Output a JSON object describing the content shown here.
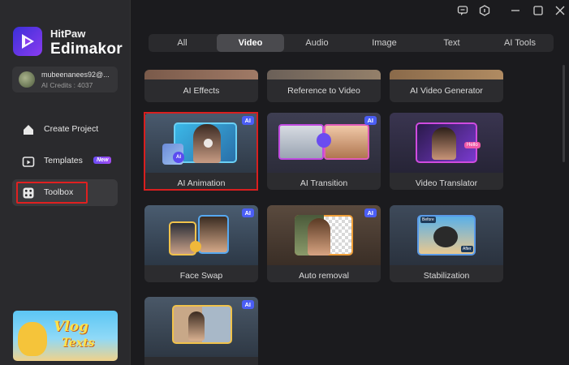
{
  "app": {
    "brand_top": "HitPaw",
    "brand_main": "Edimakor"
  },
  "account": {
    "email": "mubeenanees92@...",
    "credits": "AI Credits : 4037"
  },
  "sidebar": {
    "items": [
      {
        "label": "Create Project",
        "icon": "home-icon"
      },
      {
        "label": "Templates",
        "icon": "templates-icon",
        "badge": "New"
      },
      {
        "label": "Toolbox",
        "icon": "toolbox-icon",
        "active": true
      }
    ],
    "banner": {
      "line1": "Vlog",
      "line2": "Texts"
    }
  },
  "tabs": [
    {
      "label": "All"
    },
    {
      "label": "Video",
      "active": true
    },
    {
      "label": "Audio"
    },
    {
      "label": "Image"
    },
    {
      "label": "Text"
    },
    {
      "label": "AI Tools"
    }
  ],
  "tools": {
    "row0": [
      {
        "title": "AI Effects"
      },
      {
        "title": "Reference to Video"
      },
      {
        "title": "AI Video Generator"
      }
    ],
    "row1": [
      {
        "title": "AI Animation",
        "badge": "AI"
      },
      {
        "title": "AI Transition",
        "badge": "AI"
      },
      {
        "title": "Video Translator"
      }
    ],
    "row2": [
      {
        "title": "Face Swap",
        "badge": "AI"
      },
      {
        "title": "Auto removal",
        "badge": "AI"
      },
      {
        "title": "Stabilization"
      }
    ],
    "row3": [
      {
        "title": "",
        "badge": "AI"
      }
    ]
  },
  "thumb_labels": {
    "hello": "Hello",
    "before": "Before",
    "after": "After"
  },
  "colors": {
    "accent": "#4b5ef5",
    "highlight": "#e02020",
    "background": "#1b1b1e",
    "sidebar": "#2a2a2d"
  }
}
